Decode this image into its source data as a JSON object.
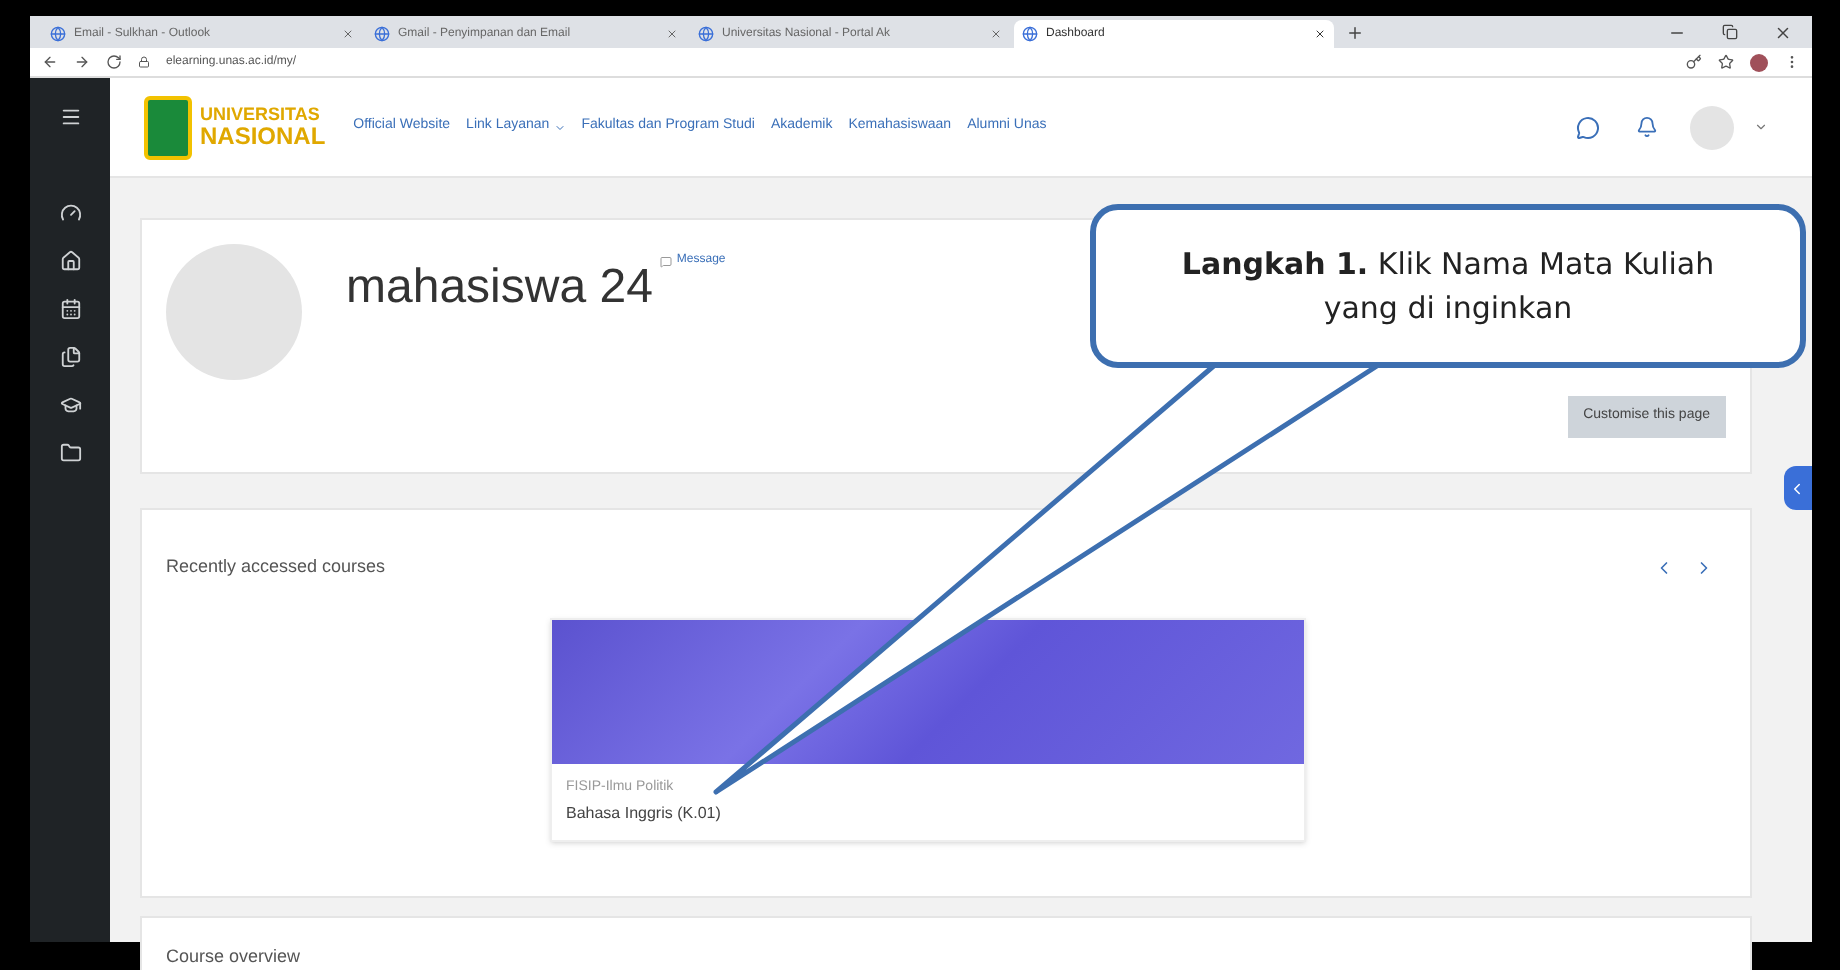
{
  "browser": {
    "tabs": [
      {
        "title": "Email - Sulkhan - Outlook",
        "selected": false
      },
      {
        "title": "Gmail - Penyimpanan dan Email",
        "selected": false
      },
      {
        "title": "Universitas Nasional - Portal Ak",
        "selected": false
      },
      {
        "title": "Dashboard",
        "selected": true
      }
    ],
    "url": "elearning.unas.ac.id/my/"
  },
  "navbar": {
    "logo_top": "UNIVERSITAS",
    "logo_bottom": "NASIONAL",
    "links": [
      {
        "label": "Official Website",
        "has_menu": false
      },
      {
        "label": "Link Layanan",
        "has_menu": true
      },
      {
        "label": "Fakultas dan Program Studi",
        "has_menu": false
      },
      {
        "label": "Akademik",
        "has_menu": false
      },
      {
        "label": "Kemahasiswaan",
        "has_menu": false
      },
      {
        "label": "Alumni Unas",
        "has_menu": false
      }
    ]
  },
  "profile": {
    "name": "mahasiswa 24",
    "message": "Message",
    "customise_button": "Customise this page"
  },
  "recent": {
    "title": "Recently accessed courses",
    "courses": [
      {
        "category": "FISIP-Ilmu Politik",
        "name": "Bahasa Inggris (K.01)"
      }
    ]
  },
  "overview": {
    "title": "Course overview"
  },
  "callout": {
    "text": "**Langkah 1.** Klik Nama Mata Kuliah yang di inginkan"
  }
}
